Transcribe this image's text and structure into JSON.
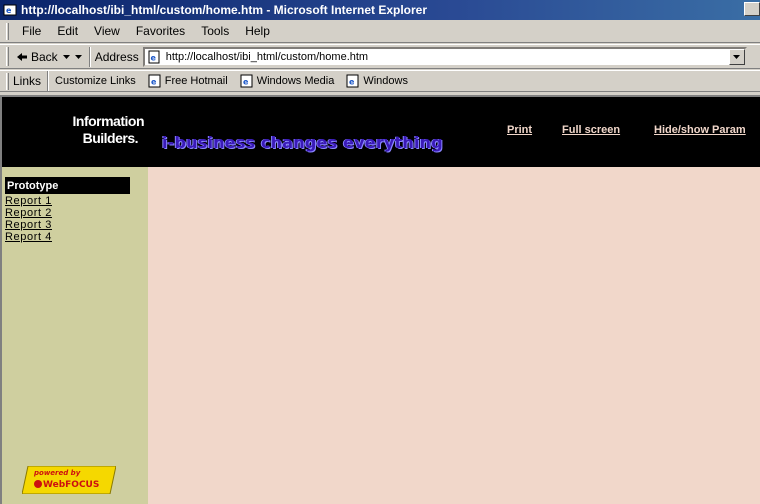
{
  "window": {
    "title": "http://localhost/ibi_html/custom/home.htm - Microsoft Internet Explorer"
  },
  "menu": [
    "File",
    "Edit",
    "View",
    "Favorites",
    "Tools",
    "Help"
  ],
  "toolbar": {
    "back_label": "Back",
    "address_label": "Address",
    "address_value": "http://localhost/ibi_html/custom/home.htm"
  },
  "links_bar": {
    "label": "Links",
    "items": [
      "Customize Links",
      "Free Hotmail",
      "Windows Media",
      "Windows"
    ]
  },
  "page": {
    "logo_line1": "Information",
    "logo_line2": "Builders.",
    "tagline": "i-business changes everything",
    "nav": {
      "print": "Print",
      "full_screen": "Full screen",
      "hide_show": "Hide/show Param"
    },
    "sidebar": {
      "header": "Prototype",
      "reports": [
        "Report 1",
        "Report 2",
        "Report 3",
        "Report 4"
      ]
    },
    "badge": {
      "line1": "powered by",
      "line2": "WebFOCUS"
    }
  },
  "colors": {
    "header_bg": "#000000",
    "content_bg": "#f1d7ca",
    "sidebar_bg": "#cfcf9f",
    "tagline": "#3a1ab8",
    "badge_yellow": "#f5d800",
    "badge_red": "#cc1010"
  }
}
